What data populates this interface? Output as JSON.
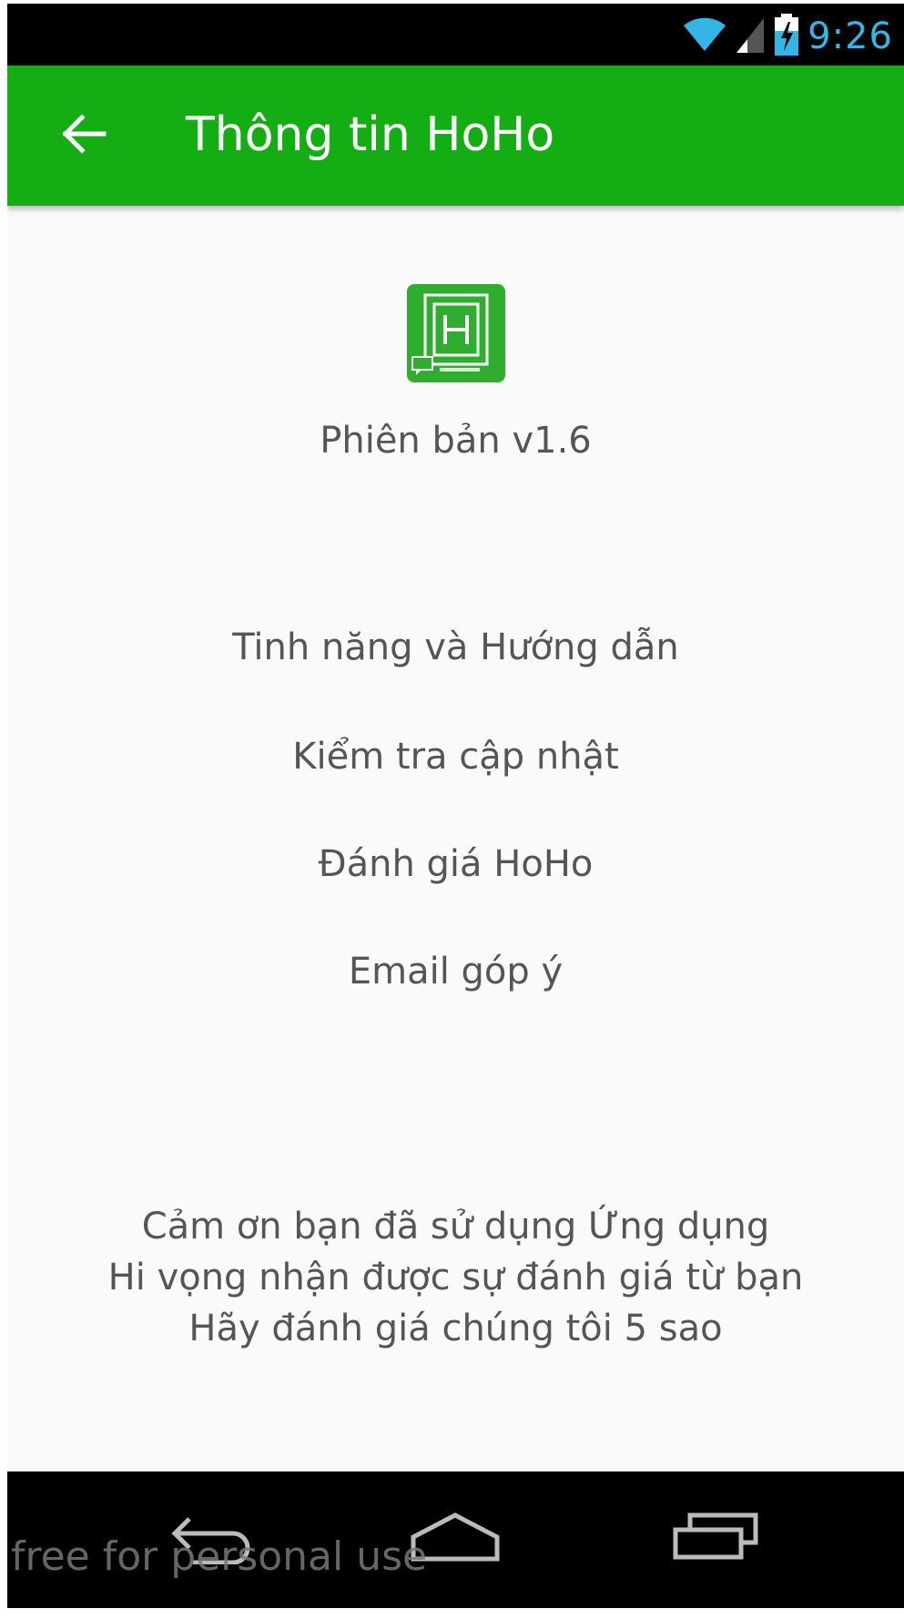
{
  "status_bar": {
    "time": "9:26",
    "icons": [
      "wifi-icon",
      "signal-icon",
      "battery-charging-icon"
    ],
    "time_color": "#33b5e5"
  },
  "app_bar": {
    "title": "Thông tin HoHo",
    "background": "#14ae14",
    "back_icon": "arrow-left-icon"
  },
  "about": {
    "logo_icon": "hoho-app-logo",
    "version": "Phiên bản v1.6"
  },
  "menu": {
    "items": [
      {
        "label": "Tinh năng và Hướng dẫn"
      },
      {
        "label": "Kiểm tra cập nhật"
      },
      {
        "label": "Đánh giá HoHo"
      },
      {
        "label": "Email góp ý"
      }
    ]
  },
  "footer_message": {
    "lines": [
      "Cảm ơn bạn đã sử dụng Ứng dụng",
      "Hi vọng nhận được sự đánh giá từ bạn",
      "Hãy đánh giá chúng tôi 5 sao"
    ]
  },
  "nav_bar": {
    "buttons": [
      "back-icon",
      "home-icon",
      "recents-icon"
    ]
  },
  "watermark": "free for personal use"
}
